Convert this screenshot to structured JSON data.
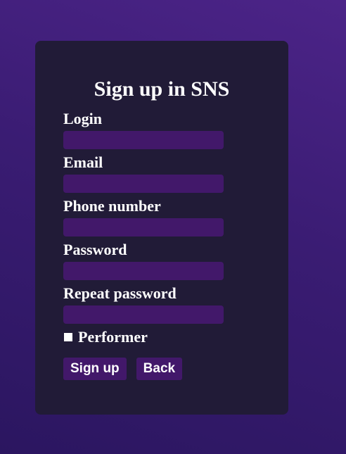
{
  "form": {
    "title": "Sign up in SNS",
    "fields": [
      {
        "label": "Login",
        "value": ""
      },
      {
        "label": "Email",
        "value": ""
      },
      {
        "label": "Phone number",
        "value": ""
      },
      {
        "label": "Password",
        "value": ""
      },
      {
        "label": "Repeat password",
        "value": ""
      }
    ],
    "checkbox": {
      "label": "Performer",
      "checked": false
    },
    "buttons": {
      "signup_label": "Sign up",
      "back_label": "Back"
    }
  },
  "colors": {
    "background": "#3a1c73",
    "card": "#211b37",
    "input": "#42186a",
    "button": "#42186a",
    "text": "#ffffff"
  }
}
